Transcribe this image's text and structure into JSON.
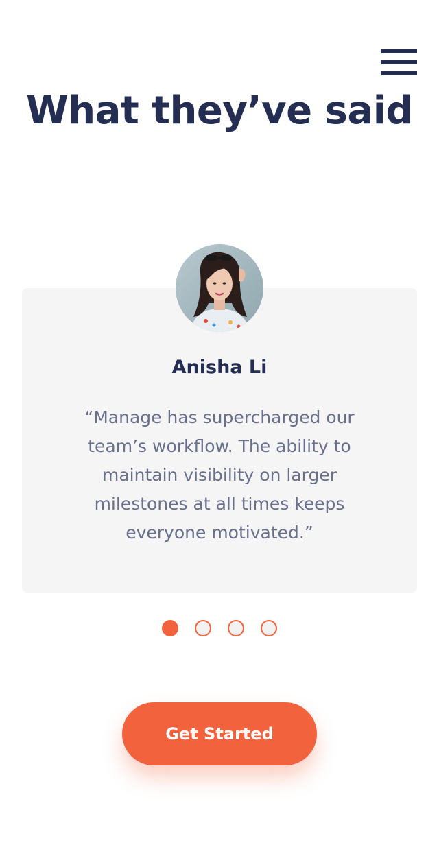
{
  "header": {
    "menu_icon": "hamburger-menu-icon"
  },
  "section": {
    "title": "What they’ve said"
  },
  "testimonial": {
    "avatar_icon": "user-avatar-photo",
    "name": "Anisha Li",
    "quote": "“Manage has supercharged our team’s workflow. The ability to maintain visibility on larger milestones at all times keeps everyone motivated.”"
  },
  "carousel": {
    "total_slides": 4,
    "active_index": 0
  },
  "cta": {
    "label": "Get Started"
  },
  "colors": {
    "primary_dark": "#242d52",
    "accent": "#f2623c",
    "card_bg": "#f5f5f5",
    "body_text": "#6a6f8c"
  }
}
